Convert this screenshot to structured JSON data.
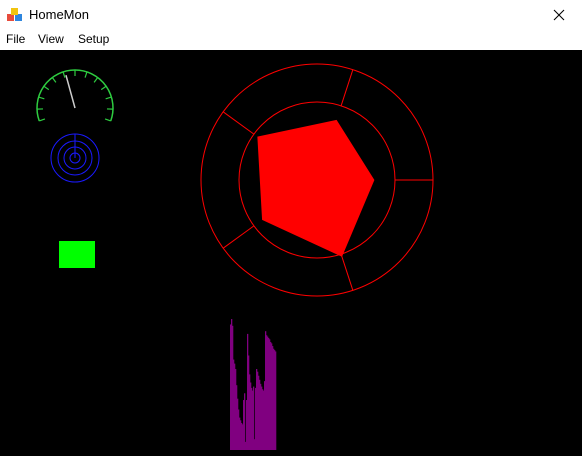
{
  "window": {
    "title": "HomeMon",
    "icon": "app-blocks-icon",
    "close_icon": "close-icon"
  },
  "menu": {
    "items": [
      "File",
      "View",
      "Setup"
    ]
  },
  "widgets": {
    "gauge": {
      "color": "#2ecc40",
      "level": 0.43,
      "ticks": 13
    },
    "rings": {
      "color": "#1a1aff",
      "count": 4
    },
    "indicator": {
      "color": "#00ff00"
    },
    "radar": {
      "color": "#ff0000",
      "axes": 5,
      "levels": 2,
      "values": [
        0.49,
        0.54,
        0.63,
        0.58,
        0.69
      ]
    },
    "bar_histogram": {
      "color": "#800080",
      "values": [
        0.93,
        0.97,
        0.92,
        0.67,
        0.64,
        0.6,
        0.48,
        0.38,
        0.3,
        0.24,
        0.22,
        0.2,
        0.19,
        0.37,
        0.42,
        0.06,
        0.37,
        0.86,
        0.7,
        0.56,
        0.5,
        0.46,
        0.44,
        0.47,
        0.08,
        0.46,
        0.6,
        0.58,
        0.55,
        0.52,
        0.49,
        0.47,
        0.45,
        0.44,
        0.51,
        0.88,
        0.85,
        0.84,
        0.83,
        0.82,
        0.8,
        0.79,
        0.77,
        0.75,
        0.74,
        0.73
      ]
    }
  }
}
